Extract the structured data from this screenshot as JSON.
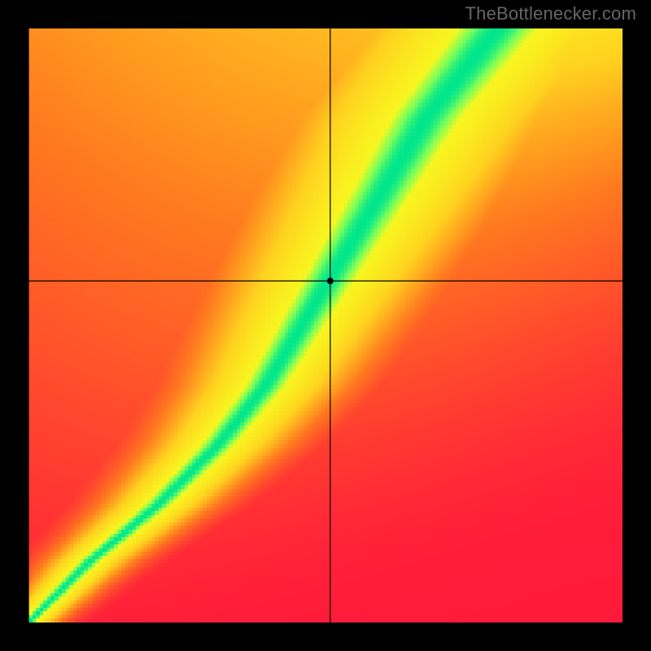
{
  "attribution": "TheBottlenecker.com",
  "chart_data": {
    "type": "heatmap",
    "title": "",
    "xlabel": "",
    "ylabel": "",
    "xlim": [
      0,
      1
    ],
    "ylim": [
      0,
      1
    ],
    "crosshair": {
      "x": 0.508,
      "y": 0.575
    },
    "marker": {
      "x": 0.508,
      "y": 0.575,
      "radius": 4,
      "color": "#000000"
    },
    "ridge": {
      "description": "Locus of best-fit (green) points; x as function of y, normalized 0..1 from bottom-left",
      "points": [
        {
          "y": 0.0,
          "x": 0.0
        },
        {
          "y": 0.05,
          "x": 0.05
        },
        {
          "y": 0.1,
          "x": 0.1
        },
        {
          "y": 0.15,
          "x": 0.16
        },
        {
          "y": 0.2,
          "x": 0.22
        },
        {
          "y": 0.25,
          "x": 0.27
        },
        {
          "y": 0.3,
          "x": 0.32
        },
        {
          "y": 0.35,
          "x": 0.36
        },
        {
          "y": 0.4,
          "x": 0.4
        },
        {
          "y": 0.45,
          "x": 0.43
        },
        {
          "y": 0.5,
          "x": 0.46
        },
        {
          "y": 0.55,
          "x": 0.49
        },
        {
          "y": 0.6,
          "x": 0.52
        },
        {
          "y": 0.65,
          "x": 0.55
        },
        {
          "y": 0.7,
          "x": 0.58
        },
        {
          "y": 0.75,
          "x": 0.61
        },
        {
          "y": 0.8,
          "x": 0.64
        },
        {
          "y": 0.85,
          "x": 0.67
        },
        {
          "y": 0.9,
          "x": 0.71
        },
        {
          "y": 0.95,
          "x": 0.75
        },
        {
          "y": 1.0,
          "x": 0.79
        }
      ]
    },
    "palette": {
      "description": "value 0→1 mapped via stops",
      "stops": [
        {
          "v": 0.0,
          "color": "#ff1a3a"
        },
        {
          "v": 0.35,
          "color": "#ff7a1f"
        },
        {
          "v": 0.6,
          "color": "#ffd21f"
        },
        {
          "v": 0.8,
          "color": "#f8f820"
        },
        {
          "v": 0.92,
          "color": "#7aff5a"
        },
        {
          "v": 1.0,
          "color": "#00e68c"
        }
      ]
    },
    "field": {
      "description": "Scalar field f(x,y)∈[0,1]; peak along ridge, falloff width grows with y, left side falls faster (to red), right side slower (plateaus orange).",
      "ridge_width_bottom": 0.018,
      "ridge_width_top": 0.1,
      "left_floor": 0.0,
      "right_floor_bottom": 0.05,
      "right_floor_top": 0.55
    }
  }
}
